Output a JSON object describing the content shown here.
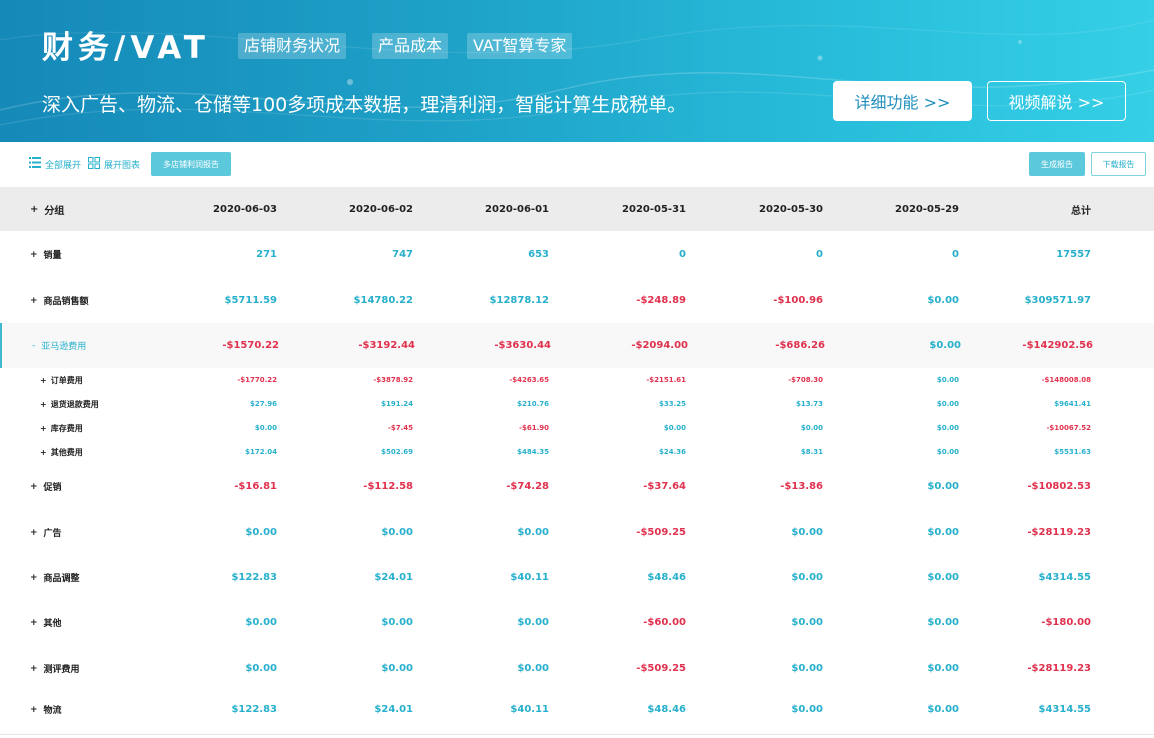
{
  "banner": {
    "title": "财务/VAT",
    "tags": [
      "店铺财务状况",
      "产品成本",
      "VAT智算专家"
    ],
    "tagline": "深入广告、物流、仓储等100多项成本数据，理清利润，智能计算生成税单。",
    "detail_button": "详细功能 >>",
    "video_button": "视频解说 >>"
  },
  "toolbar": {
    "expand_all": "全部展开",
    "expand_chart": "展开图表",
    "multi_store_report": "多店铺利润报告",
    "generate_report": "生成报告",
    "download_report": "下载报告"
  },
  "table": {
    "headers": [
      "分组",
      "2020-06-03",
      "2020-06-02",
      "2020-06-01",
      "2020-05-31",
      "2020-05-30",
      "2020-05-29",
      "总计"
    ],
    "rows": [
      {
        "kind": "main",
        "toggle": "+",
        "label": "销量",
        "values": [
          "271",
          "747",
          "653",
          "0",
          "0",
          "0",
          "17557"
        ]
      },
      {
        "kind": "main",
        "toggle": "+",
        "label": "商品销售额",
        "values": [
          "$5711.59",
          "$14780.22",
          "$12878.12",
          "-$248.89",
          "-$100.96",
          "$0.00",
          "$309571.97"
        ]
      },
      {
        "kind": "main highlight",
        "toggle": "-",
        "label": "亚马逊费用",
        "values": [
          "-$1570.22",
          "-$3192.44",
          "-$3630.44",
          "-$2094.00",
          "-$686.26",
          "$0.00",
          "-$142902.56"
        ]
      },
      {
        "kind": "sub",
        "toggle": "+",
        "label": "订单费用",
        "values": [
          "-$1770.22",
          "-$3878.92",
          "-$4263.65",
          "-$2151.61",
          "-$708.30",
          "$0.00",
          "-$148008.08"
        ]
      },
      {
        "kind": "sub",
        "toggle": "+",
        "label": "退货退款费用",
        "values": [
          "$27.96",
          "$191.24",
          "$210.76",
          "$33.25",
          "$13.73",
          "$0.00",
          "$9641.41"
        ]
      },
      {
        "kind": "sub",
        "toggle": "+",
        "label": "库存费用",
        "values": [
          "$0.00",
          "-$7.45",
          "-$61.90",
          "$0.00",
          "$0.00",
          "$0.00",
          "-$10067.52"
        ]
      },
      {
        "kind": "sub",
        "toggle": "+",
        "label": "其他费用",
        "values": [
          "$172.04",
          "$502.69",
          "$484.35",
          "$24.36",
          "$8.31",
          "$0.00",
          "$5531.63"
        ]
      },
      {
        "kind": "main",
        "toggle": "+",
        "label": "促销",
        "values": [
          "-$16.81",
          "-$112.58",
          "-$74.28",
          "-$37.64",
          "-$13.86",
          "$0.00",
          "-$10802.53"
        ]
      },
      {
        "kind": "main",
        "toggle": "+",
        "label": "广告",
        "values": [
          "$0.00",
          "$0.00",
          "$0.00",
          "-$509.25",
          "$0.00",
          "$0.00",
          "-$28119.23"
        ]
      },
      {
        "kind": "main",
        "toggle": "+",
        "label": "商品调整",
        "values": [
          "$122.83",
          "$24.01",
          "$40.11",
          "$48.46",
          "$0.00",
          "$0.00",
          "$4314.55"
        ]
      },
      {
        "kind": "main",
        "toggle": "+",
        "label": "其他",
        "values": [
          "$0.00",
          "$0.00",
          "$0.00",
          "-$60.00",
          "$0.00",
          "$0.00",
          "-$180.00"
        ]
      },
      {
        "kind": "main",
        "toggle": "+",
        "label": "测评费用",
        "values": [
          "$0.00",
          "$0.00",
          "$0.00",
          "-$509.25",
          "$0.00",
          "$0.00",
          "-$28119.23"
        ]
      },
      {
        "kind": "main",
        "toggle": "+",
        "label": "物流",
        "values": [
          "$122.83",
          "$24.01",
          "$40.11",
          "$48.46",
          "$0.00",
          "$0.00",
          "$4314.55"
        ]
      }
    ]
  },
  "colors": {
    "positive": "#27b0cc",
    "negative": "#e0314e",
    "accent": "#5cc8dc"
  }
}
